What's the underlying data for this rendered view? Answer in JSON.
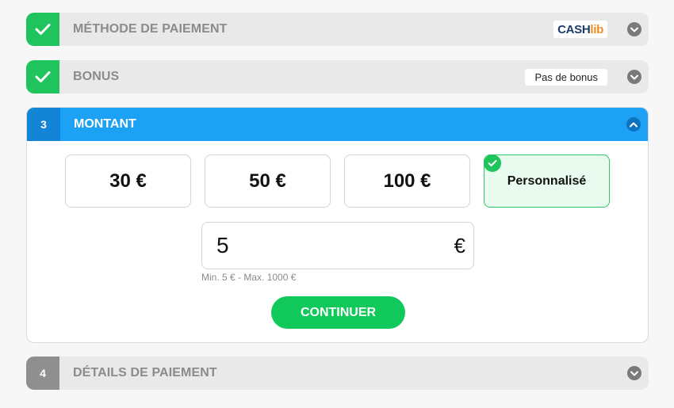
{
  "steps": {
    "payment_method": {
      "title": "MÉTHODE DE PAIEMENT",
      "logo_part1": "CASH",
      "logo_part2": "lib"
    },
    "bonus": {
      "title": "BONUS",
      "value": "Pas de bonus"
    },
    "amount": {
      "number": "3",
      "title": "MONTANT"
    },
    "payment_details": {
      "number": "4",
      "title": "DÉTAILS DE PAIEMENT"
    }
  },
  "amount_options": [
    {
      "label": "30 €"
    },
    {
      "label": "50 €"
    },
    {
      "label": "100 €"
    },
    {
      "label": "Personnalisé",
      "selected": true
    }
  ],
  "amount_input": {
    "value": "5",
    "currency": "€",
    "hint": "Min. 5 € - Max. 1000 €"
  },
  "continue_button": {
    "label": "CONTINUER"
  },
  "colors": {
    "accent": "#1da1f5",
    "success": "#1fc45c",
    "button": "#10c95a",
    "muted": "#8f8f8f"
  },
  "icons": [
    "check-icon",
    "chevron-down-icon",
    "chevron-up-icon"
  ]
}
